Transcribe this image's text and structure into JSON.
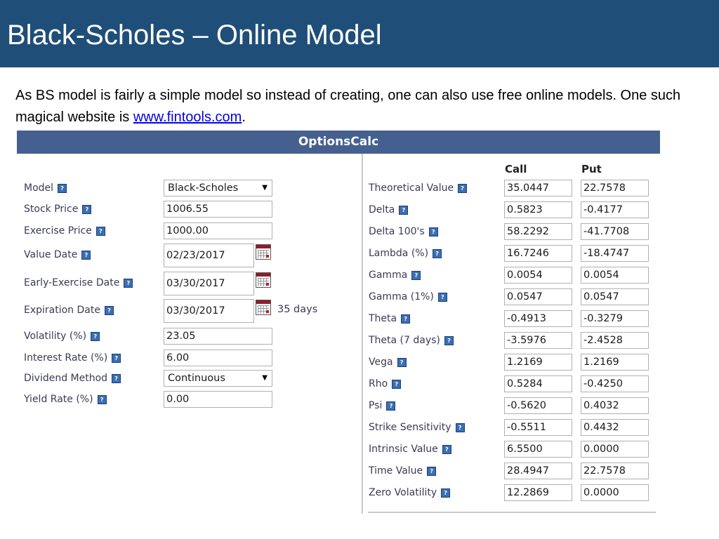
{
  "slide": {
    "title": "Black-Scholes – Online Model",
    "intro_text": "As BS model is fairly a simple model so instead of creating, one can also use free online models. One such magical website is ",
    "link_text": "www.fintools.com",
    "intro_end": "."
  },
  "calc": {
    "header": "OptionsCalc",
    "help_glyph": "?",
    "inputs": {
      "model": {
        "label": "Model",
        "value": "Black-Scholes"
      },
      "stock_price": {
        "label": "Stock Price",
        "value": "1006.55"
      },
      "exercise_price": {
        "label": "Exercise Price",
        "value": "1000.00"
      },
      "value_date": {
        "label": "Value Date",
        "value": "02/23/2017"
      },
      "early_exercise_date": {
        "label": "Early-Exercise Date",
        "value": "03/30/2017"
      },
      "expiration_date": {
        "label": "Expiration Date",
        "value": "03/30/2017",
        "days": "35 days"
      },
      "volatility": {
        "label": "Volatility (%)",
        "value": "23.05"
      },
      "interest_rate": {
        "label": "Interest Rate (%)",
        "value": "6.00"
      },
      "dividend_method": {
        "label": "Dividend Method",
        "value": "Continuous"
      },
      "yield_rate": {
        "label": "Yield Rate (%)",
        "value": "0.00"
      }
    },
    "columns": {
      "call": "Call",
      "put": "Put"
    },
    "outputs": [
      {
        "label": "Theoretical Value",
        "call": "35.0447",
        "put": "22.7578"
      },
      {
        "label": "Delta",
        "call": "0.5823",
        "put": "-0.4177"
      },
      {
        "label": "Delta 100's",
        "call": "58.2292",
        "put": "-41.7708"
      },
      {
        "label": "Lambda (%)",
        "call": "16.7246",
        "put": "-18.4747"
      },
      {
        "label": "Gamma",
        "call": "0.0054",
        "put": "0.0054"
      },
      {
        "label": "Gamma (1%)",
        "call": "0.0547",
        "put": "0.0547"
      },
      {
        "label": "Theta",
        "call": "-0.4913",
        "put": "-0.3279"
      },
      {
        "label": "Theta (7 days)",
        "call": "-3.5976",
        "put": "-2.4528"
      },
      {
        "label": "Vega",
        "call": "1.2169",
        "put": "1.2169"
      },
      {
        "label": "Rho",
        "call": "0.5284",
        "put": "-0.4250"
      },
      {
        "label": "Psi",
        "call": "-0.5620",
        "put": "0.4032"
      },
      {
        "label": "Strike Sensitivity",
        "call": "-0.5511",
        "put": "0.4432"
      },
      {
        "label": "Intrinsic Value",
        "call": "6.5500",
        "put": "0.0000"
      },
      {
        "label": "Time Value",
        "call": "28.4947",
        "put": "22.7578"
      },
      {
        "label": "Zero Volatility",
        "call": "12.2869",
        "put": "0.0000"
      }
    ]
  }
}
